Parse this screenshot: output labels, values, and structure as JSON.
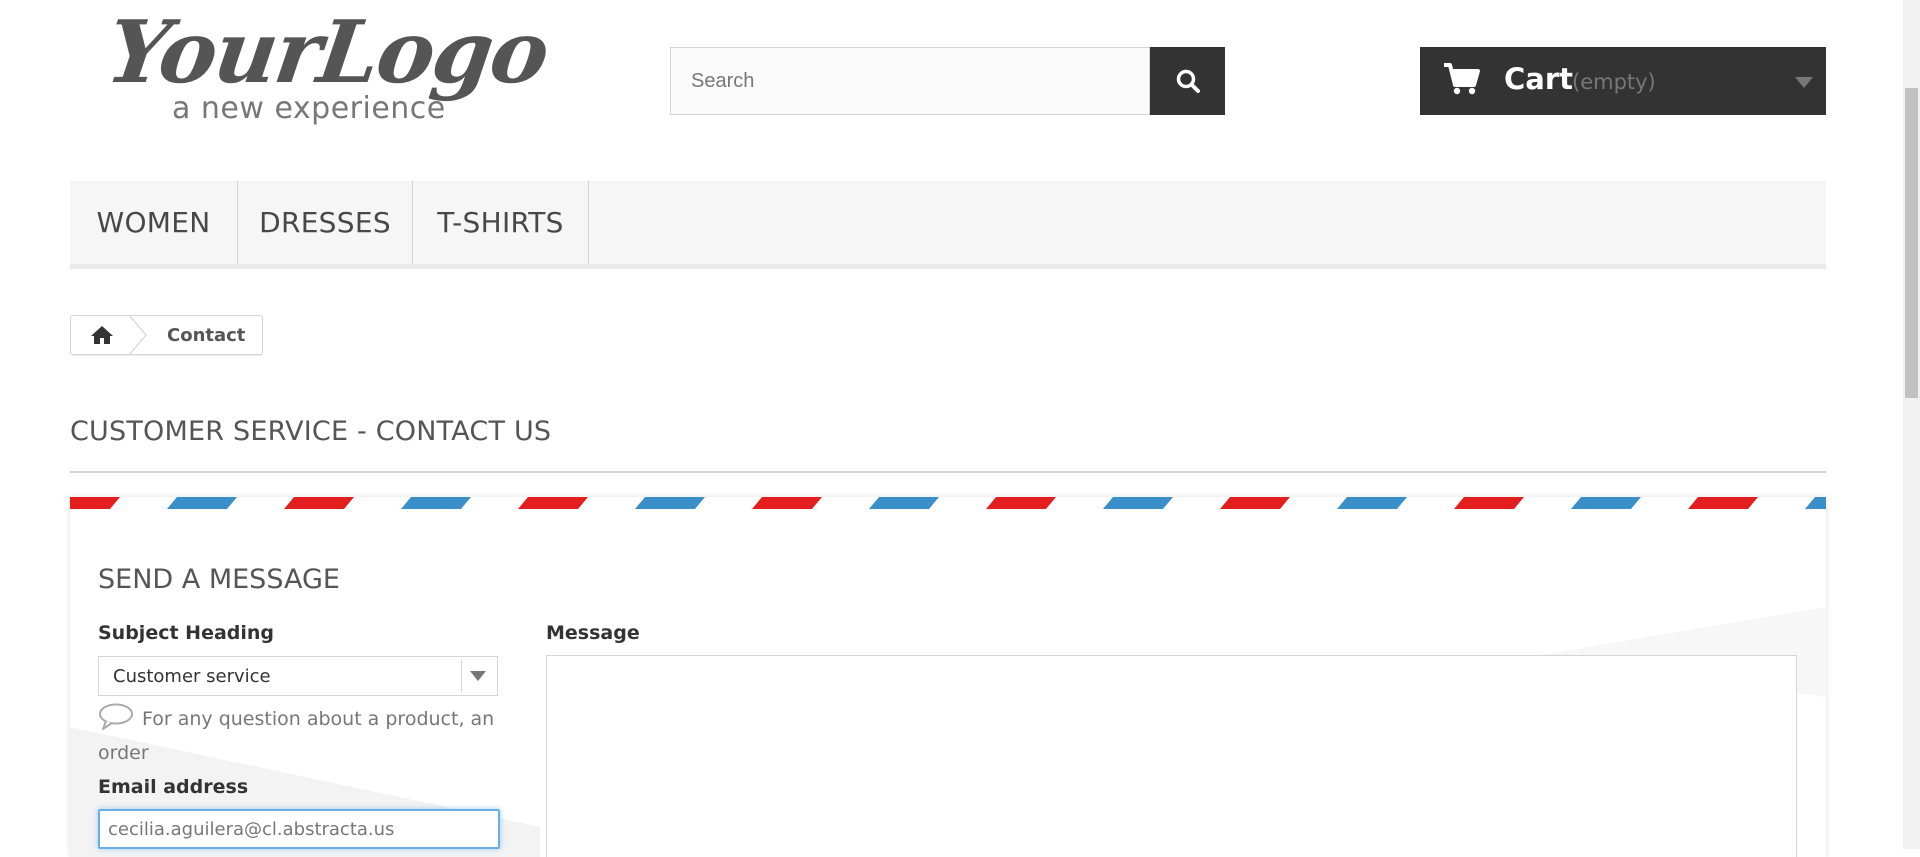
{
  "header": {
    "logo_main": "YourLogo",
    "logo_tagline": "a new experience",
    "search": {
      "placeholder": "Search",
      "button_icon": "search-icon"
    },
    "cart": {
      "label": "Cart",
      "state": "(empty)",
      "icon": "cart-icon"
    }
  },
  "nav": {
    "items": [
      {
        "label": "WOMEN"
      },
      {
        "label": "DRESSES"
      },
      {
        "label": "T-SHIRTS"
      }
    ]
  },
  "breadcrumb": {
    "home_icon": "home-icon",
    "current": "Contact"
  },
  "page": {
    "title": "CUSTOMER SERVICE - CONTACT US"
  },
  "form": {
    "title": "SEND A MESSAGE",
    "subject_label": "Subject Heading",
    "subject_value": "Customer service",
    "subject_desc": "For any question about a product, an order",
    "email_label": "Email address",
    "email_value": "cecilia.aguilera@cl.abstracta.us",
    "message_label": "Message",
    "message_value": ""
  },
  "colors": {
    "dark": "#333333",
    "nav_bg": "#f6f6f6",
    "stripe_red": "#e31e1e",
    "stripe_blue": "#3a8fc8",
    "focus_border": "#66afe9"
  }
}
